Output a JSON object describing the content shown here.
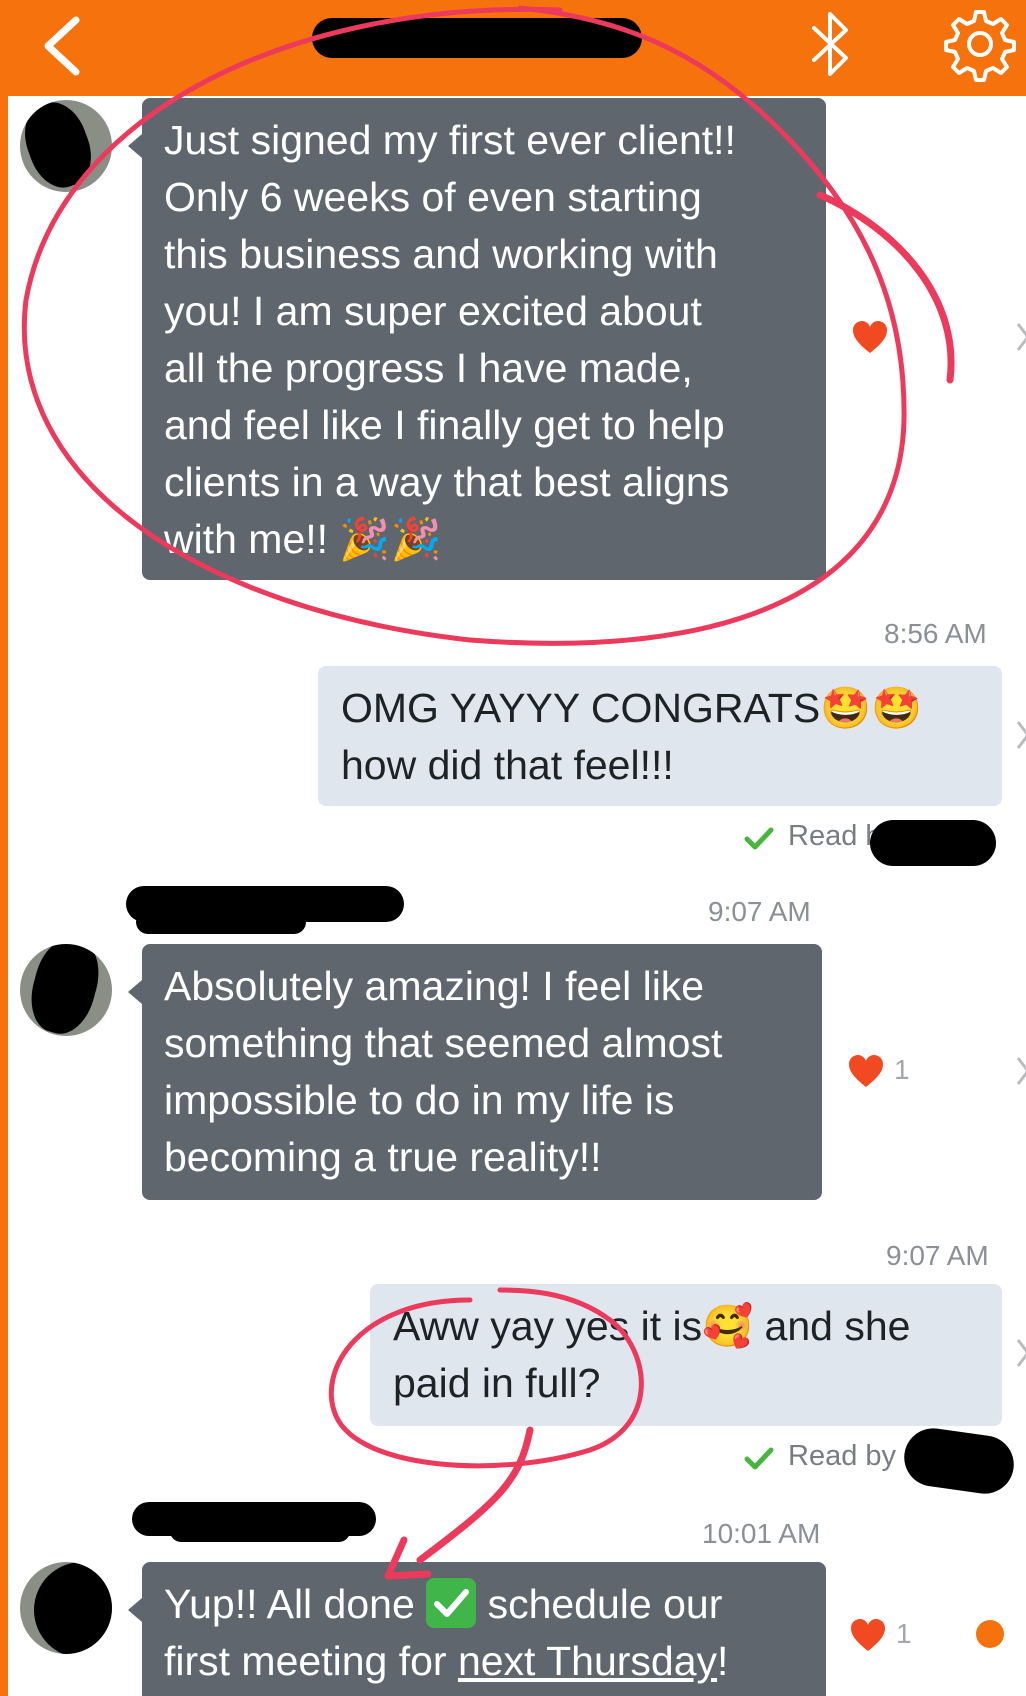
{
  "header": {
    "back_icon": "chevron-left-icon",
    "bluetooth_icon": "bluetooth-icon",
    "settings_icon": "gear-icon",
    "bar_color": "#f6720d"
  },
  "messages": [
    {
      "direction": "incoming",
      "lines": [
        "Just signed my first ever client!!",
        "Only 6 weeks of even starting",
        "this business and working with",
        "you! I am super excited about",
        "all the progress I have made,",
        "and feel like I finally get to help",
        "clients in a way that best aligns",
        "with me!! 🎉🎉"
      ],
      "reaction": ""
    },
    {
      "direction": "outgoing",
      "time": "8:56 AM",
      "lines": [
        "OMG YAYYY CONGRATS🤩🤩",
        "how did that feel!!!"
      ],
      "read_label": "Read b"
    },
    {
      "direction": "incoming",
      "time": "9:07 AM",
      "lines": [
        "Absolutely amazing! I feel like",
        "something that seemed almost",
        "impossible to do in my life is",
        "becoming a true reality!!"
      ],
      "reaction": "1"
    },
    {
      "direction": "outgoing",
      "time": "9:07 AM",
      "lines": [
        "Aww yay yes it is🥰 and she",
        "paid in full?"
      ],
      "read_label": "Read by"
    },
    {
      "direction": "incoming",
      "time": "10:01 AM",
      "line1_a": "Yup!! All done",
      "line1_b": "schedule our",
      "line2_a": "first meeting for",
      "line2_link": "next Thursday",
      "line2_b": "!",
      "reaction": "1"
    }
  ],
  "colors": {
    "incoming_bubble": "#5f666d",
    "outgoing_bubble": "#dfe6ee",
    "annotation": "#ec3a5d",
    "heart": "#f14a22",
    "read_check": "#48b53e"
  }
}
